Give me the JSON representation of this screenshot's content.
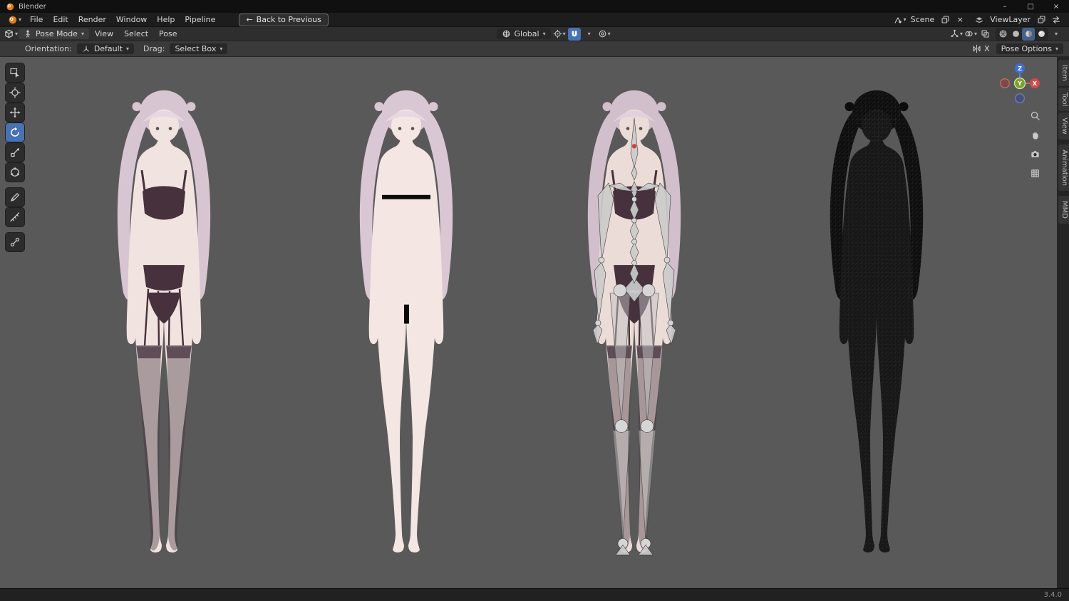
{
  "icons": {
    "chevron": "▾",
    "minimize": "–",
    "maximize": "□",
    "close": "×",
    "back_arrow": "←",
    "unlink": "×"
  },
  "titlebar": {
    "app_title": "Blender"
  },
  "menubar": {
    "items": [
      "File",
      "Edit",
      "Render",
      "Window",
      "Help",
      "Pipeline"
    ],
    "back_button": "Back to Previous",
    "scene_label": "Scene",
    "viewlayer_label": "ViewLayer"
  },
  "viewport_header": {
    "mode": "Pose Mode",
    "view_menu": "View",
    "select_menu": "Select",
    "pose_menu": "Pose",
    "orientation": "Global"
  },
  "tool_settings": {
    "orientation_label": "Orientation:",
    "orientation_value": "Default",
    "drag_label": "Drag:",
    "drag_value": "Select Box",
    "x_mirror": "X",
    "pose_options": "Pose Options"
  },
  "gizmo": {
    "x": "X",
    "y": "Y",
    "z": "Z"
  },
  "sidebar_tabs": {
    "item": "Item",
    "tool": "Tool",
    "view": "View",
    "animation": "Animation",
    "mmd": "MMD"
  },
  "statusbar": {
    "version": "3.4.0"
  },
  "viewport": {
    "background": "#595959",
    "models": {
      "clothed": "character-textured-clothed",
      "base": "character-textured-base",
      "armature": "character-with-armature-overlay",
      "wireframe": "character-wireframe"
    }
  },
  "colors": {
    "accent": "#4772b3",
    "axis_x": "#d04c4c",
    "axis_y": "#7ba32c",
    "axis_z": "#3f6ed6",
    "viewport_bg": "#595959"
  }
}
